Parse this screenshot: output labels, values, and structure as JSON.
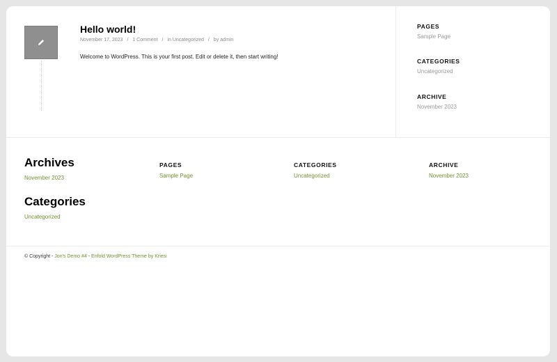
{
  "post": {
    "title": "Hello world!",
    "date": "November 17, 2023",
    "comments": "1 Comment",
    "category_prefix": "in",
    "category": "Uncategorized",
    "author_prefix": "by",
    "author": "admin",
    "separator": "/",
    "content": "Welcome to WordPress. This is your first post. Edit or delete it, then start writing!",
    "icon": "pencil-icon"
  },
  "sidebar": {
    "pages_title": "PAGES",
    "pages_link": "Sample Page",
    "categories_title": "CATEGORIES",
    "categories_link": "Uncategorized",
    "archive_title": "ARCHIVE",
    "archive_link": "November 2023"
  },
  "footer_widgets": {
    "archives_title": "Archives",
    "archives_link": "November 2023",
    "categories_title": "Categories",
    "categories_link": "Uncategorized",
    "pages_title": "PAGES",
    "pages_link": "Sample Page",
    "cat_col_title": "CATEGORIES",
    "cat_col_link": "Uncategorized",
    "archive_col_title": "ARCHIVE",
    "archive_col_link": "November 2023"
  },
  "copyright": {
    "prefix": "© Copyright -",
    "site_link": "Jon's Demo #4",
    "dash": "-",
    "theme_link": "Enfold WordPress Theme by Kriesi"
  },
  "colors": {
    "accent_green": "#719430",
    "icon_bg": "#8f8f8f",
    "frame_bg": "#e6e6e6"
  }
}
